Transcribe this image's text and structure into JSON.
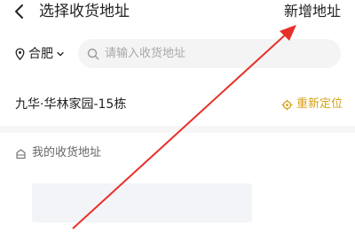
{
  "header": {
    "back_icon": "chevron-left-icon",
    "title": "选择收货地址",
    "add_address_label": "新增地址"
  },
  "location_bar": {
    "pin_icon": "map-pin-icon",
    "city": "合肥",
    "chevron_icon": "chevron-down-icon",
    "search": {
      "icon": "search-icon",
      "placeholder": "请输入收货地址",
      "value": ""
    }
  },
  "current_location": {
    "address": "九华·华林家园-15栋",
    "relocate_icon": "target-icon",
    "relocate_label": "重新定位"
  },
  "my_addresses": {
    "icon": "home-icon",
    "heading": "我的收货地址"
  },
  "colors": {
    "accent": "#d7a018",
    "text_primary": "#222222",
    "text_secondary": "#666666",
    "placeholder": "#a8a8a8",
    "search_bg": "#f4f4f4",
    "annotation_arrow": "#e8302a"
  }
}
